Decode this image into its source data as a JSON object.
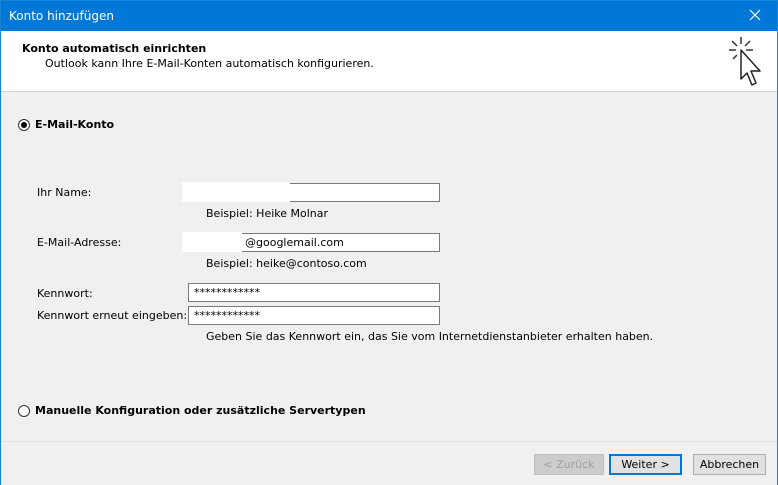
{
  "window": {
    "title": "Konto hinzufügen",
    "close_icon": "close-icon"
  },
  "header": {
    "title": "Konto automatisch einrichten",
    "subtitle": "Outlook kann Ihre E-Mail-Konten automatisch konfigurieren.",
    "icon": "wizard-cursor-icon"
  },
  "email_account": {
    "radio_label": "E-Mail-Konto",
    "selected": true,
    "name": {
      "label": "Ihr Name:",
      "value": "",
      "example": "Beispiel: Heike Molnar"
    },
    "email": {
      "label": "E-Mail-Adresse:",
      "value": "@googlemail.com",
      "example": "Beispiel: heike@contoso.com"
    },
    "password": {
      "label": "Kennwort:",
      "value": "************"
    },
    "password_repeat": {
      "label": "Kennwort erneut eingeben:",
      "value": "************",
      "hint": "Geben Sie das Kennwort ein, das Sie vom Internetdienstanbieter erhalten haben."
    }
  },
  "manual_config": {
    "radio_label": "Manuelle Konfiguration oder zusätzliche Servertypen",
    "selected": false
  },
  "buttons": {
    "back": "< Zurück",
    "next": "Weiter >",
    "cancel": "Abbrechen"
  }
}
